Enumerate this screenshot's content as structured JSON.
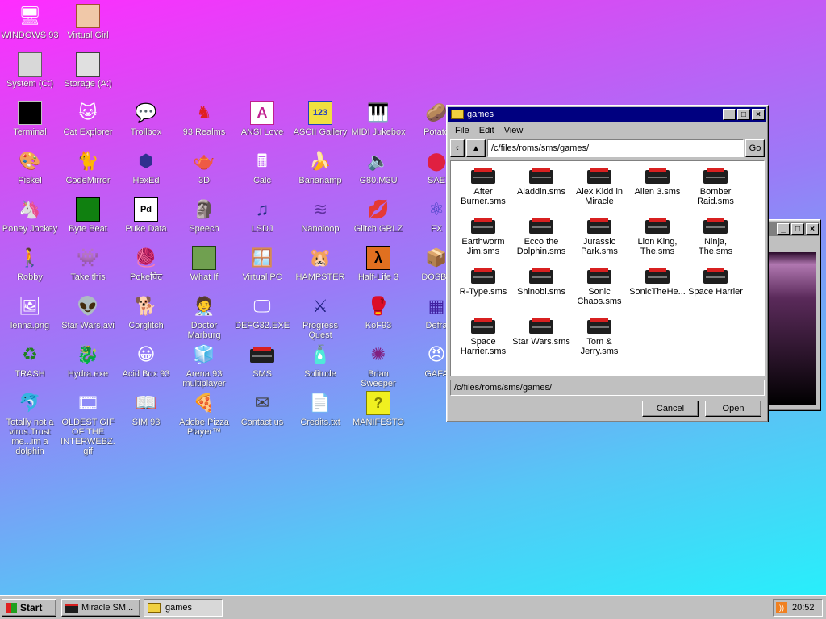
{
  "desktop_icons": [
    {
      "label": "WINDOWS 93",
      "icon": "computer-icon"
    },
    {
      "label": "Virtual Girl",
      "icon": "face-icon"
    },
    {
      "label": "System (C:)",
      "icon": "drive-icon"
    },
    {
      "label": "Storage (A:)",
      "icon": "floppy-drive-icon"
    },
    {
      "label": "Terminal",
      "icon": "terminal-icon"
    },
    {
      "label": "Cat Explorer",
      "icon": "cat-globe-icon"
    },
    {
      "label": "Trollbox",
      "icon": "chat-bubble-icon"
    },
    {
      "label": "93 Realms",
      "icon": "knight-icon"
    },
    {
      "label": "ANSI Love",
      "icon": "ansi-a-icon"
    },
    {
      "label": "ASCII Gallery",
      "icon": "ascii-123-icon"
    },
    {
      "label": "MIDI Jukebox",
      "icon": "piano-icon"
    },
    {
      "label": "Potato",
      "icon": "potato-icon"
    },
    {
      "label": "Piskel",
      "icon": "palette-icon"
    },
    {
      "label": "CodeMirror",
      "icon": "code-cat-icon"
    },
    {
      "label": "HexEd",
      "icon": "hex-cube-icon"
    },
    {
      "label": "3D",
      "icon": "teapot-icon"
    },
    {
      "label": "Calc",
      "icon": "calculator-icon"
    },
    {
      "label": "Bananamp",
      "icon": "banana-icon"
    },
    {
      "label": "G80.M3U",
      "icon": "speaker-icon"
    },
    {
      "label": "SAE",
      "icon": "checker-ball-icon"
    },
    {
      "label": "Poney Jockey",
      "icon": "pony-icon"
    },
    {
      "label": "Byte Beat",
      "icon": "byte-beat-icon"
    },
    {
      "label": "Puke Data",
      "icon": "pd-icon"
    },
    {
      "label": "Speech",
      "icon": "speech-face-icon"
    },
    {
      "label": "LSDJ",
      "icon": "lsdj-icon"
    },
    {
      "label": "Nanoloop",
      "icon": "nanoloop-icon"
    },
    {
      "label": "Glitch GRLZ",
      "icon": "lips-icon"
    },
    {
      "label": "FX",
      "icon": "atom-icon"
    },
    {
      "label": "Robby",
      "icon": "stick-figure-icon"
    },
    {
      "label": "Take this",
      "icon": "pixel-face-icon"
    },
    {
      "label": "Pokeघिट",
      "icon": "poke-ball-icon"
    },
    {
      "label": "What If",
      "icon": "what-if-icon"
    },
    {
      "label": "Virtual PC",
      "icon": "virtual-pc-icon"
    },
    {
      "label": "HAMPSTER",
      "icon": "hamster-icon"
    },
    {
      "label": "Half-Life 3",
      "icon": "lambda-icon"
    },
    {
      "label": "DOSBo",
      "icon": "dosbox-icon"
    },
    {
      "label": "lenna.png",
      "icon": "image-file-icon"
    },
    {
      "label": "Star Wars.avi",
      "icon": "yoda-icon"
    },
    {
      "label": "Corglitch",
      "icon": "corgi-icon"
    },
    {
      "label": "Doctor Marburg",
      "icon": "doctor-icon"
    },
    {
      "label": "DEFG32.EXE",
      "icon": "monitor-face-icon"
    },
    {
      "label": "Progress Quest",
      "icon": "swords-icon"
    },
    {
      "label": "KoF93",
      "icon": "fighter-icon"
    },
    {
      "label": "Defra",
      "icon": "defrag-icon"
    },
    {
      "label": "TRASH",
      "icon": "recycle-bin-icon"
    },
    {
      "label": "Hydra.exe",
      "icon": "hydra-icon"
    },
    {
      "label": "Acid Box 93",
      "icon": "smiley-icon"
    },
    {
      "label": "Arena 93 multiplayer",
      "icon": "arena-cube-icon"
    },
    {
      "label": "SMS",
      "icon": "sms-console-icon"
    },
    {
      "label": "Solitude",
      "icon": "solitude-icon"
    },
    {
      "label": "Brian Sweeper",
      "icon": "mine-icon"
    },
    {
      "label": "GAFA",
      "icon": "doom-face-icon"
    },
    {
      "label": "Totally not a virus.Trust me...im a dolphin",
      "icon": "dolphin-icon"
    },
    {
      "label": "OLDEST GIF OF THE INTERWEBZ.gif",
      "icon": "gif-file-icon"
    },
    {
      "label": "SIM 93",
      "icon": "sim-book-icon"
    },
    {
      "label": "Adobe Pizza Player™",
      "icon": "pizza-icon"
    },
    {
      "label": "Contact us",
      "icon": "contact-icon"
    },
    {
      "label": "Credits.txt",
      "icon": "text-file-icon"
    },
    {
      "label": "MANIFESTO",
      "icon": "question-mark-icon"
    }
  ],
  "colors": {
    "titlebar_active": "#000080",
    "titlebar_inactive": "#808080",
    "window_face": "#c0c0c0",
    "sms_red": "#d82020"
  },
  "games_window": {
    "title": "games",
    "menu": [
      "File",
      "Edit",
      "View"
    ],
    "path": "/c/files/roms/sms/games/",
    "go_label": "Go",
    "files": [
      "After Burner.sms",
      "Aladdin.sms",
      "Alex Kidd in Miracle",
      "Alien 3.sms",
      "Bomber Raid.sms",
      "Earthworm Jim.sms",
      "Ecco the Dolphin.sms",
      "Jurassic Park.sms",
      "Lion King, The.sms",
      "Ninja, The.sms",
      "R-Type.sms",
      "Shinobi.sms",
      "Sonic Chaos.sms",
      "SonicTheHe...",
      "Space Harrier",
      "Space Harrier.sms",
      "Star Wars.sms",
      "Tom & Jerry.sms"
    ],
    "filename_value": "/c/files/roms/sms/games/",
    "cancel_label": "Cancel",
    "open_label": "Open"
  },
  "taskbar": {
    "start_label": "Start",
    "items": [
      {
        "label": "Miracle SM..."
      },
      {
        "label": "games"
      }
    ],
    "clock": "20:52"
  }
}
